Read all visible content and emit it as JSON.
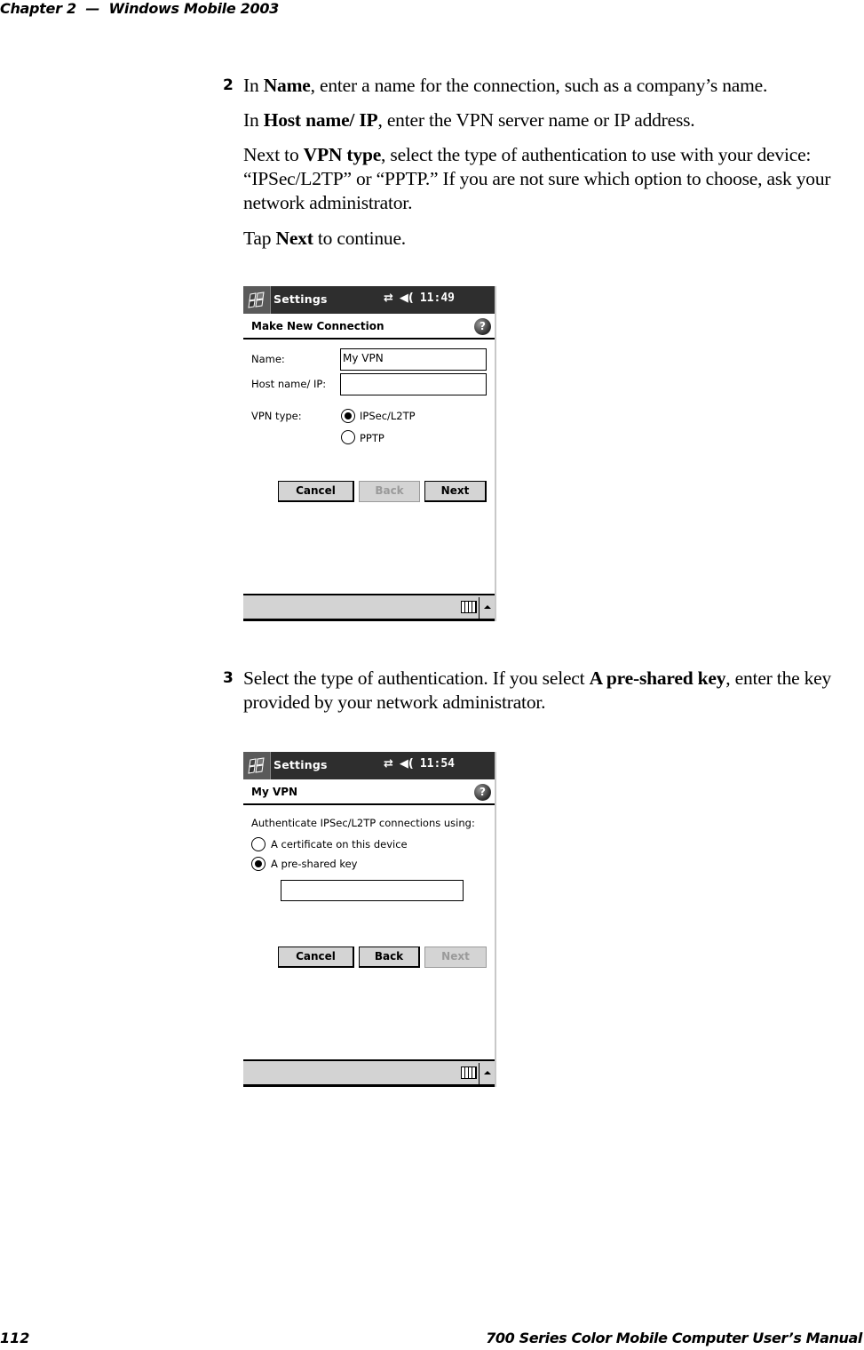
{
  "header": {
    "chapter": "Chapter 2  —  Windows Mobile 2003"
  },
  "footer": {
    "page_number": "112",
    "manual_title": "700 Series Color Mobile Computer User’s Manual"
  },
  "step2": {
    "number": "2",
    "p1": {
      "pre": "In ",
      "bold": "Name",
      "post": ", enter a name for the connection, such as a company’s name."
    },
    "p2": {
      "pre": "In ",
      "bold": "Host name/ IP",
      "post": ", enter the VPN server name or IP address."
    },
    "p3": {
      "pre": "Next to ",
      "bold": "VPN type",
      "post": ", select the type of authentication to use with your device: “IPSec/L2TP” or “PPTP.” If you are not sure which option to choose, ask your network administrator."
    },
    "p4": {
      "pre": "Tap ",
      "bold": "Next",
      "post": " to continue."
    }
  },
  "screen1": {
    "titlebar": {
      "app": "Settings",
      "connectivity_icon": "⇄",
      "speaker_icon": "◀(",
      "time": "11:49"
    },
    "subtitle": "Make New Connection",
    "help": "?",
    "name_label": "Name:",
    "name_value": "My VPN",
    "host_label": "Host name/ IP:",
    "host_value": "",
    "vpn_type_label": "VPN type:",
    "vpn_options": [
      {
        "label": "IPSec/L2TP",
        "checked": true
      },
      {
        "label": "PPTP",
        "checked": false
      }
    ],
    "buttons": {
      "cancel": "Cancel",
      "back": "Back",
      "next": "Next"
    },
    "buttons_disabled": {
      "back": true,
      "next": false
    }
  },
  "step3": {
    "number": "3",
    "p1": {
      "pre": "Select the type of authentication. If you select ",
      "bold": "A pre-shared key",
      "post": ", enter the key provided by your network administrator."
    }
  },
  "screen2": {
    "titlebar": {
      "app": "Settings",
      "connectivity_icon": "⇄",
      "speaker_icon": "◀(",
      "time": "11:54"
    },
    "subtitle": "My VPN",
    "help": "?",
    "prompt": "Authenticate IPSec/L2TP connections using:",
    "auth_options": [
      {
        "label": "A certificate on this device",
        "checked": false
      },
      {
        "label": "A pre-shared key",
        "checked": true
      }
    ],
    "key_value": "",
    "buttons": {
      "cancel": "Cancel",
      "back": "Back",
      "next": "Next"
    },
    "buttons_disabled": {
      "back": false,
      "next": true
    }
  }
}
